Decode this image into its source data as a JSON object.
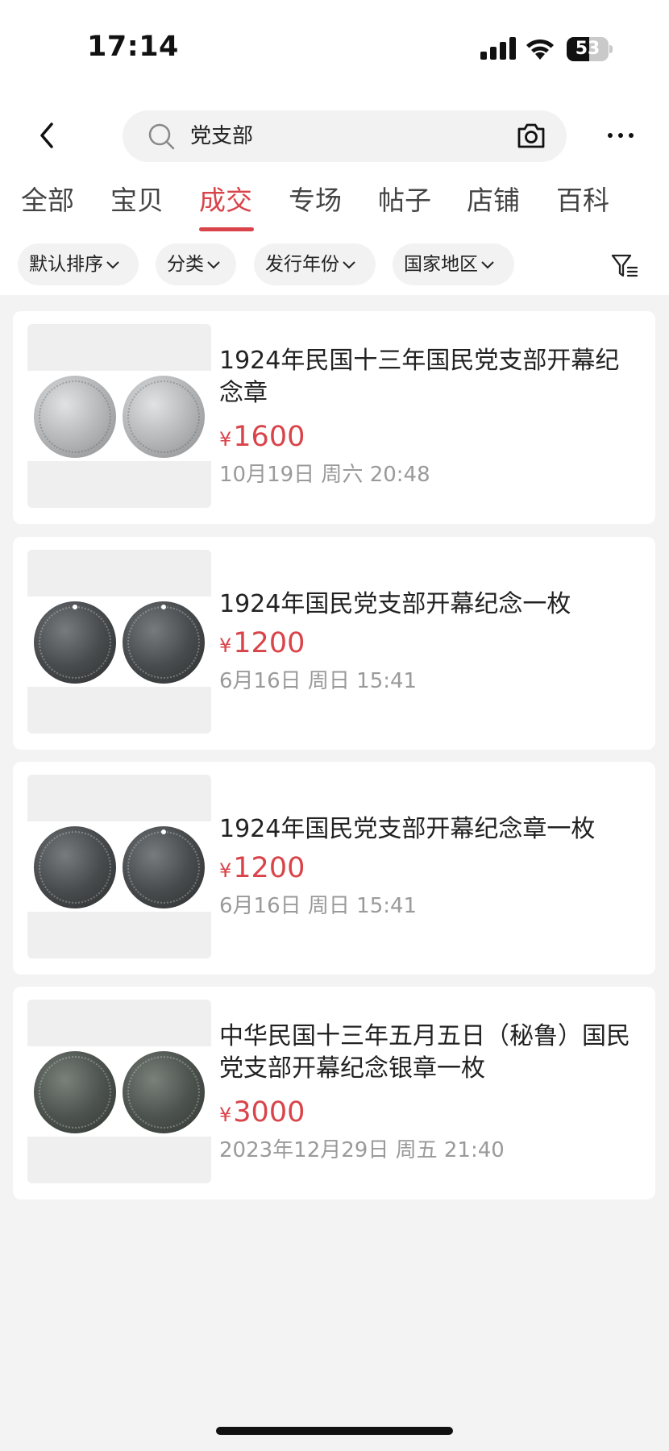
{
  "status_bar": {
    "time": "17:14",
    "battery_level": "53",
    "battery_fraction": 0.53
  },
  "search": {
    "query": "党支部",
    "icons": [
      "search-icon",
      "camera-icon"
    ]
  },
  "header": {
    "back_icon": "chevron-left-icon",
    "more_icon": "more-horizontal-icon"
  },
  "tabs": [
    {
      "label": "全部"
    },
    {
      "label": "宝贝"
    },
    {
      "label": "成交"
    },
    {
      "label": "专场"
    },
    {
      "label": "帖子"
    },
    {
      "label": "店铺"
    },
    {
      "label": "百科"
    }
  ],
  "active_tab": "成交",
  "filters": [
    {
      "label": "默认排序"
    },
    {
      "label": "分类"
    },
    {
      "label": "发行年份"
    },
    {
      "label": "国家地区"
    }
  ],
  "filter_icon": "funnel-icon",
  "items": [
    {
      "title": "1924年民国十三年国民党支部开幕纪念章",
      "price": "1600",
      "currency": "¥",
      "date": "10月19日 周六 20:48"
    },
    {
      "title": "1924年国民党支部开幕纪念一枚",
      "price": "1200",
      "currency": "¥",
      "date": "6月16日 周日 15:41"
    },
    {
      "title": "1924年国民党支部开幕纪念章一枚",
      "price": "1200",
      "currency": "¥",
      "date": "6月16日 周日 15:41"
    },
    {
      "title": "中华民国十三年五月五日（秘鲁）国民党支部开幕纪念银章一枚",
      "price": "3000",
      "currency": "¥",
      "date": "2023年12月29日 周五 21:40"
    }
  ],
  "colors": {
    "accent": "#d9444a",
    "background": "#f3f3f3",
    "muted_text": "#9a9a9a"
  }
}
